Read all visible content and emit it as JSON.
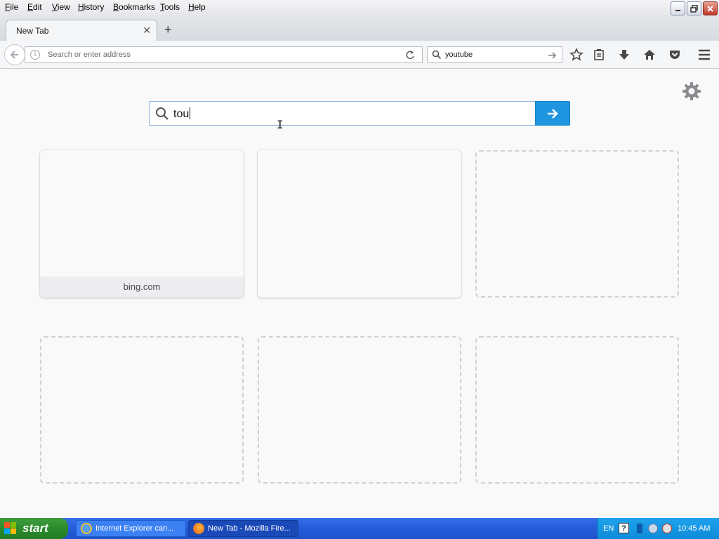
{
  "menubar": {
    "items": [
      {
        "key": "F",
        "rest": "ile"
      },
      {
        "key": "E",
        "rest": "dit"
      },
      {
        "key": "V",
        "rest": "iew"
      },
      {
        "key": "H",
        "rest": "istory"
      },
      {
        "key": "B",
        "rest": "ookmarks"
      },
      {
        "key": "T",
        "rest": "ools"
      },
      {
        "key": "H",
        "rest": "elp"
      }
    ]
  },
  "tab": {
    "title": "New Tab",
    "close_glyph": "✕",
    "new_tab_glyph": "+"
  },
  "urlbar": {
    "placeholder": "Search or enter address"
  },
  "searchbar": {
    "value": "youtube"
  },
  "newtab_search": {
    "value": "tou"
  },
  "tiles": {
    "row1": [
      {
        "label": "bing.com"
      }
    ]
  },
  "taskbar": {
    "start_label": "start",
    "tasks": [
      {
        "label": "Internet Explorer can..."
      },
      {
        "label": "New Tab - Mozilla Fire..."
      }
    ],
    "tray": {
      "lang": "EN",
      "help": "?",
      "time": "10:45 AM"
    }
  },
  "colors": {
    "accent": "#1f95e0",
    "taskbar": "#245edc",
    "start": "#2b8a2b"
  }
}
